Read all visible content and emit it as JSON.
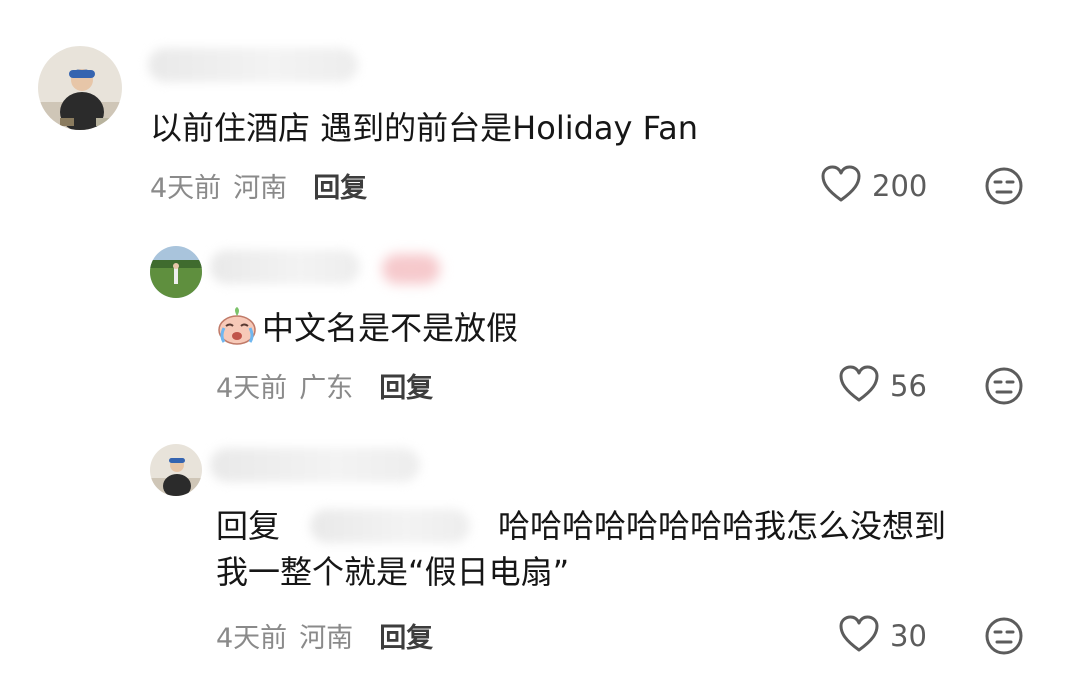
{
  "comments": [
    {
      "avatar": "user-avatar-photo",
      "text": "以前住酒店 遇到的前台是Holiday Fan",
      "time": "4天前",
      "location": "河南",
      "reply_label": "回复",
      "likes": "200"
    },
    {
      "avatar": "user-avatar-photo",
      "emoji": "crying-baby-emoji",
      "text": "中文名是不是放假",
      "time": "4天前",
      "location": "广东",
      "reply_label": "回复",
      "likes": "56"
    },
    {
      "avatar": "user-avatar-photo",
      "reply_prefix": "回复",
      "text_line1": "哈哈哈哈哈哈哈哈我怎么没想到",
      "text_line2": "我一整个就是“假日电扇”",
      "time": "4天前",
      "location": "河南",
      "reply_label": "回复",
      "likes": "30"
    }
  ],
  "icons": {
    "like": "heart-outline-icon",
    "dislike": "meh-face-icon"
  },
  "colors": {
    "meta_text": "#8a8a8a",
    "primary_text": "#161616"
  }
}
